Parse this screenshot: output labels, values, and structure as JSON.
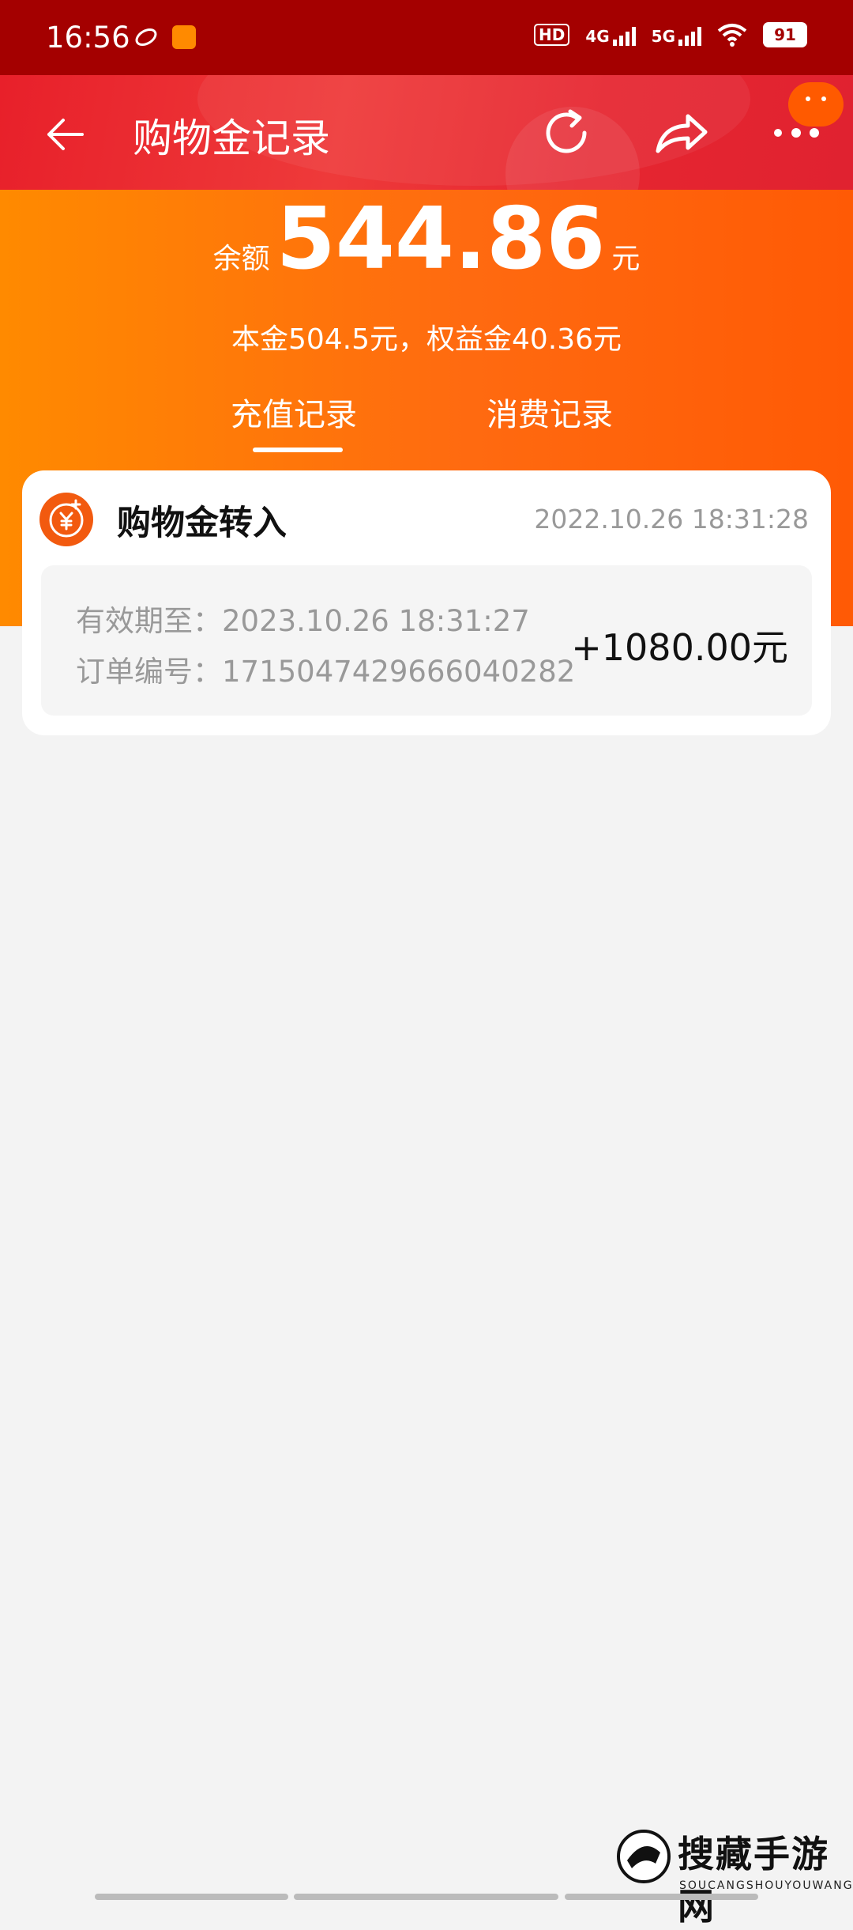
{
  "status_bar": {
    "time": "16:56",
    "network1": "4G",
    "network2": "5G",
    "battery": "91"
  },
  "header": {
    "title": "购物金记录"
  },
  "balance": {
    "label": "余额",
    "value": "544.86",
    "unit": "元",
    "breakdown": "本金504.5元，权益金40.36元"
  },
  "tabs": [
    {
      "label": "充值记录",
      "active": true
    },
    {
      "label": "消费记录",
      "active": false
    }
  ],
  "records": [
    {
      "title": "购物金转入",
      "time": "2022.10.26 18:31:28",
      "valid_until": "有效期至：2023.10.26 18:31:27",
      "order_no": "订单编号：1715047429666040282",
      "amount": "+1080.00元"
    }
  ],
  "watermark": {
    "text": "搜藏手游网",
    "sub": "SOUCANGSHOUYOUWANG"
  },
  "colors": {
    "status_bar": "#a40000",
    "header": "#e8202a",
    "orange": "#ff7a00"
  }
}
